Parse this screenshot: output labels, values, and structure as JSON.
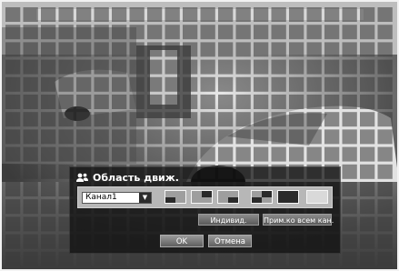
{
  "dialog": {
    "title": "Область движ.",
    "channel_select": {
      "value": "Канал1"
    },
    "individual_label": "Индивид.",
    "apply_all_label": "Прим.ко всем кан.",
    "ok_label": "OK",
    "cancel_label": "Отмена"
  },
  "colors": {
    "grid_cell": "#3a3a3a",
    "dialog_bg": "#0e0e0e",
    "panel_bg": "#b7b7b7",
    "button": "#7a7a7a"
  },
  "icons": [
    "user-icon",
    "dropdown-arrow-icon"
  ],
  "motion_grid": {
    "columns": 22,
    "rows": 15
  }
}
